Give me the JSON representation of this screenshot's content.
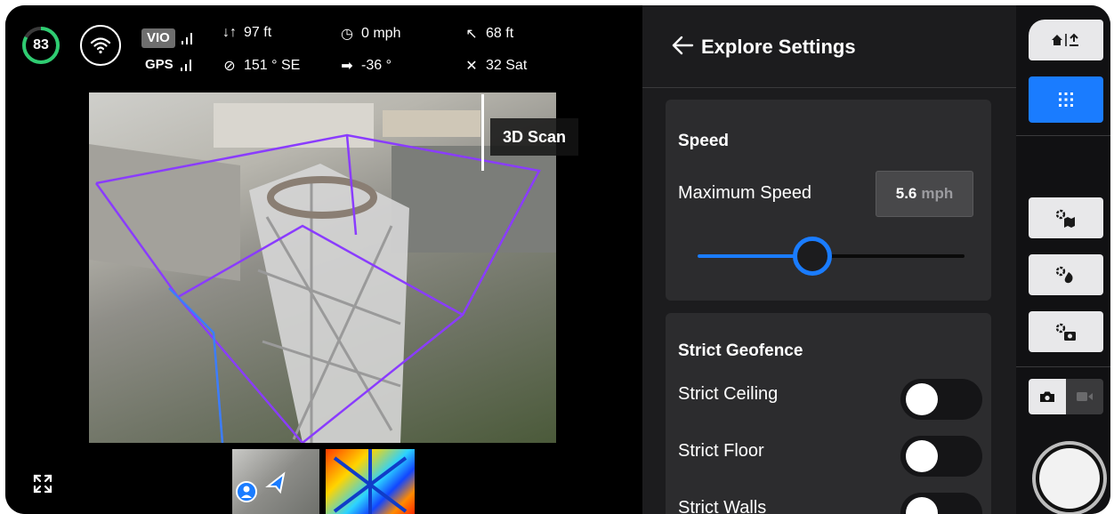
{
  "telemetry": {
    "battery": "83",
    "vio_label": "VIO",
    "gps_label": "GPS",
    "altitude": "97 ft",
    "heading": "151 ° SE",
    "speed": "0 mph",
    "gimbal_pitch": "-36 °",
    "distance": "68 ft",
    "satellites": "32 Sat",
    "battery_color": "#2ecc71"
  },
  "camera": {
    "mode_label": "3D Scan",
    "overlay_color": "#8a3cff"
  },
  "panel": {
    "title": "Explore Settings",
    "speed_section": {
      "title": "Speed",
      "max_speed_label": "Maximum Speed",
      "max_speed_value": "5.6",
      "max_speed_unit": "mph",
      "slider_level": 0.43
    },
    "geofence_section": {
      "title": "Strict Geofence",
      "items": [
        {
          "label": "Strict Ceiling",
          "on": false
        },
        {
          "label": "Strict Floor",
          "on": false
        },
        {
          "label": "Strict Walls",
          "on": false
        }
      ]
    }
  },
  "rail": {
    "accent_color": "#1a7cff",
    "buttons": [
      "home-launch-icon",
      "grid-icon",
      "map-settings-icon",
      "obstacle-settings-icon",
      "camera-settings-icon"
    ],
    "capture_mode": "photo"
  }
}
